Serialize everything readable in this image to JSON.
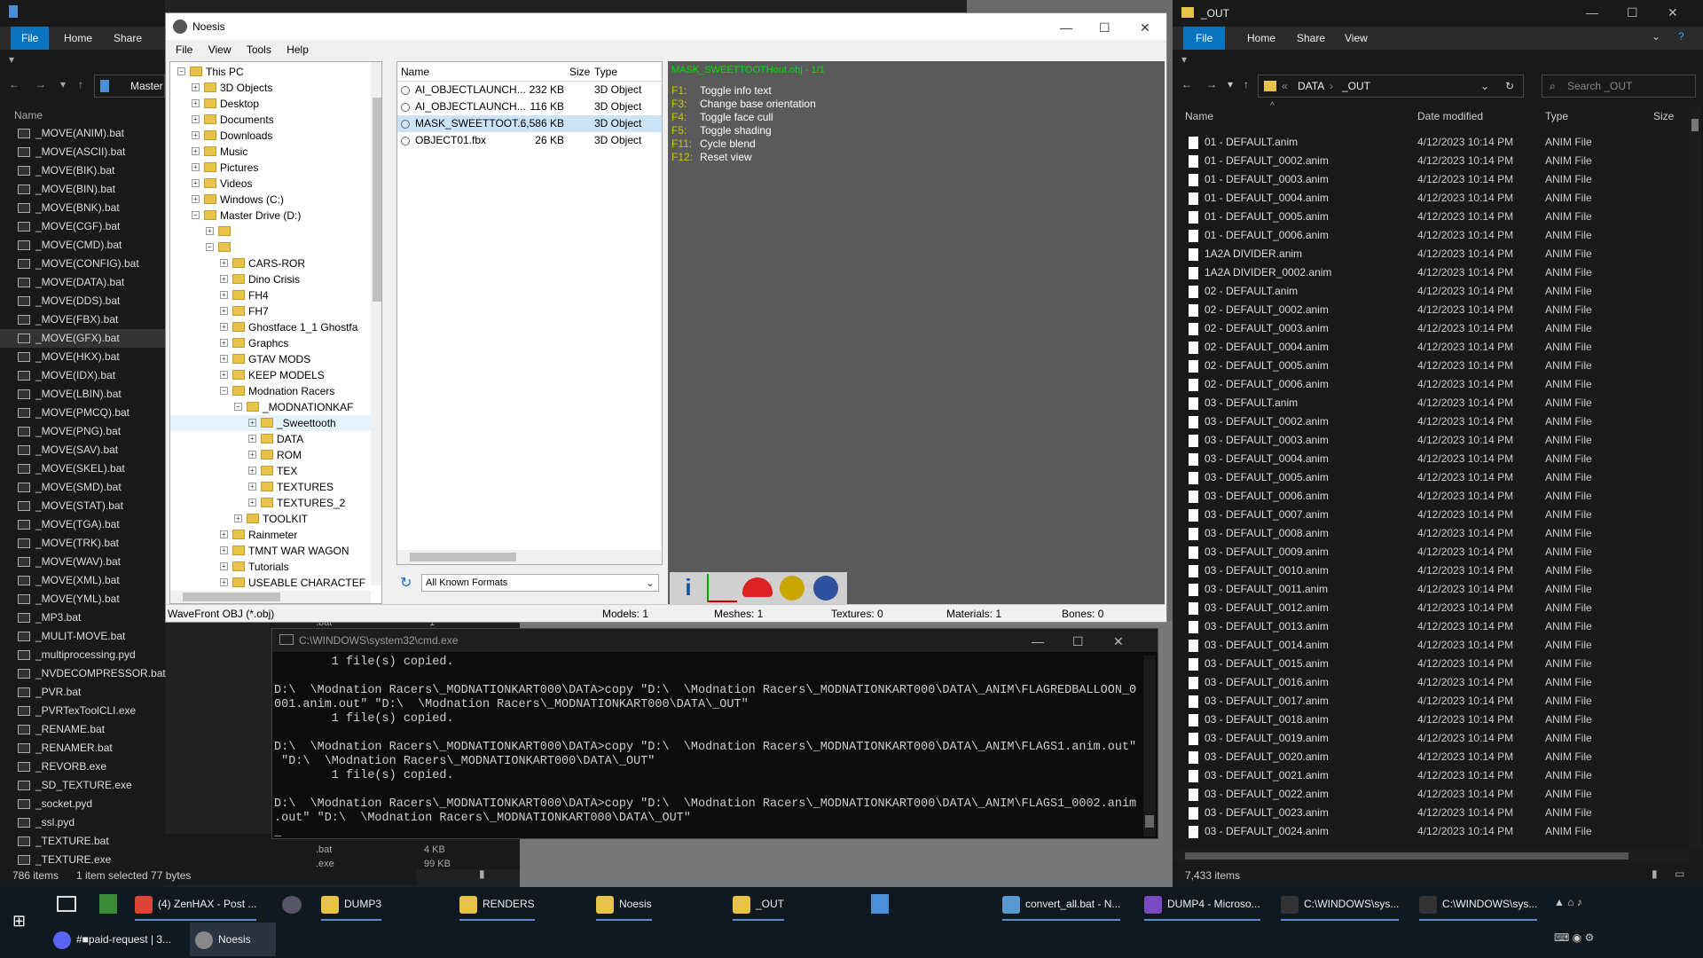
{
  "left_explorer": {
    "ribbon": {
      "file": "File",
      "home": "Home",
      "share": "Share"
    },
    "address": "Master",
    "col_name": "Name",
    "files": [
      "_MOVE(ANIM).bat",
      "_MOVE(ASCII).bat",
      "_MOVE(BIK).bat",
      "_MOVE(BIN).bat",
      "_MOVE(BNK).bat",
      "_MOVE(CGF).bat",
      "_MOVE(CMD).bat",
      "_MOVE(CONFIG).bat",
      "_MOVE(DATA).bat",
      "_MOVE(DDS).bat",
      "_MOVE(FBX).bat",
      "_MOVE(GFX).bat",
      "_MOVE(HKX).bat",
      "_MOVE(IDX).bat",
      "_MOVE(LBIN).bat",
      "_MOVE(PMCQ).bat",
      "_MOVE(PNG).bat",
      "_MOVE(SAV).bat",
      "_MOVE(SKEL).bat",
      "_MOVE(SMD).bat",
      "_MOVE(STAT).bat",
      "_MOVE(TGA).bat",
      "_MOVE(TRK).bat",
      "_MOVE(WAV).bat",
      "_MOVE(XML).bat",
      "_MOVE(YML).bat",
      "_MP3.bat",
      "_MULIT-MOVE.bat",
      "_multiprocessing.pyd",
      "_NVDECOMPRESSOR.bat",
      "_PVR.bat",
      "_PVRTexToolCLI.exe",
      "_RENAME.bat",
      "_RENAMER.bat",
      "_REVORB.exe",
      "_SD_TEXTURE.exe",
      "_socket.pyd",
      "_ssl.pyd",
      "_TEXTURE.bat",
      "_TEXTURE.exe"
    ],
    "status": "786 items",
    "status_sel": "1 item selected  77 bytes",
    "extra_type": ".bat",
    "extra_size": "4 KB",
    "extra_type2": ".exe",
    "extra_size2": "99 KB",
    "extra_type0": ".bat",
    "extra_size0": "1 KB"
  },
  "noesis": {
    "title": "Noesis",
    "menu": [
      "File",
      "View",
      "Tools",
      "Help"
    ],
    "tree": [
      {
        "label": "This PC",
        "indent": 0
      },
      {
        "label": "3D Objects",
        "indent": 1
      },
      {
        "label": "Desktop",
        "indent": 1
      },
      {
        "label": "Documents",
        "indent": 1
      },
      {
        "label": "Downloads",
        "indent": 1
      },
      {
        "label": "Music",
        "indent": 1
      },
      {
        "label": "Pictures",
        "indent": 1
      },
      {
        "label": "Videos",
        "indent": 1
      },
      {
        "label": "Windows  (C:)",
        "indent": 1
      },
      {
        "label": "Master Drive (D:)",
        "indent": 1
      },
      {
        "label": "",
        "indent": 2
      },
      {
        "label": "",
        "indent": 2
      },
      {
        "label": "CARS-ROR",
        "indent": 3
      },
      {
        "label": "Dino Crisis",
        "indent": 3
      },
      {
        "label": "FH4",
        "indent": 3
      },
      {
        "label": "FH7",
        "indent": 3
      },
      {
        "label": "Ghostface 1_1 Ghostfa",
        "indent": 3
      },
      {
        "label": "Graphcs",
        "indent": 3
      },
      {
        "label": "GTAV MODS",
        "indent": 3
      },
      {
        "label": "KEEP MODELS",
        "indent": 3
      },
      {
        "label": "Modnation Racers",
        "indent": 3
      },
      {
        "label": "_MODNATIONKAF",
        "indent": 4
      },
      {
        "label": "_Sweettooth",
        "indent": 5
      },
      {
        "label": "DATA",
        "indent": 5
      },
      {
        "label": "ROM",
        "indent": 5
      },
      {
        "label": "TEX",
        "indent": 5
      },
      {
        "label": "TEXTURES",
        "indent": 5
      },
      {
        "label": "TEXTURES_2",
        "indent": 5
      },
      {
        "label": "TOOLKIT",
        "indent": 4
      },
      {
        "label": "Rainmeter",
        "indent": 3
      },
      {
        "label": "TMNT WAR WAGON",
        "indent": 3
      },
      {
        "label": "Tutorials",
        "indent": 3
      },
      {
        "label": "USEABLE CHARACTEF",
        "indent": 3
      }
    ],
    "file_cols": {
      "name": "Name",
      "size": "Size",
      "type": "Type"
    },
    "files": [
      {
        "name": "AI_OBJECTLAUNCH...",
        "size": "232 KB",
        "type": "3D Object"
      },
      {
        "name": "AI_OBJECTLAUNCH...",
        "size": "116 KB",
        "type": "3D Object"
      },
      {
        "name": "MASK_SWEETTOOT...",
        "size": "6,586 KB",
        "type": "3D Object"
      },
      {
        "name": "OBJECT01.fbx",
        "size": "26 KB",
        "type": "3D Object"
      }
    ],
    "format_select": "All Known Formats",
    "viewer_title": "MASK_SWEETTOOTHout.obj - 1/1",
    "help": [
      {
        "key": "F1:",
        "text": "Toggle info text"
      },
      {
        "key": "F3:",
        "text": "Change base orientation"
      },
      {
        "key": "F4:",
        "text": "Toggle face cull"
      },
      {
        "key": "F5:",
        "text": "Toggle shading"
      },
      {
        "key": "F11:",
        "text": "Cycle blend"
      },
      {
        "key": "F12:",
        "text": "Reset view"
      }
    ],
    "status": {
      "format": "WaveFront OBJ (*.obj)",
      "models": "Models: 1",
      "meshes": "Meshes: 1",
      "textures": "Textures: 0",
      "materials": "Materials: 1",
      "bones": "Bones: 0"
    }
  },
  "cmd": {
    "title": "C:\\WINDOWS\\system32\\cmd.exe",
    "lines": [
      "        1 file(s) copied.",
      "",
      "D:\\  \\Modnation Racers\\_MODNATIONKART000\\DATA>copy \"D:\\  \\Modnation Racers\\_MODNATIONKART000\\DATA\\_ANIM\\FLAGREDBALLOON_0",
      "001.anim.out\" \"D:\\  \\Modnation Racers\\_MODNATIONKART000\\DATA\\_OUT\"",
      "        1 file(s) copied.",
      "",
      "D:\\  \\Modnation Racers\\_MODNATIONKART000\\DATA>copy \"D:\\  \\Modnation Racers\\_MODNATIONKART000\\DATA\\_ANIM\\FLAGS1.anim.out\"",
      " \"D:\\  \\Modnation Racers\\_MODNATIONKART000\\DATA\\_OUT\"",
      "        1 file(s) copied.",
      "",
      "D:\\  \\Modnation Racers\\_MODNATIONKART000\\DATA>copy \"D:\\  \\Modnation Racers\\_MODNATIONKART000\\DATA\\_ANIM\\FLAGS1_0002.anim",
      ".out\" \"D:\\  \\Modnation Racers\\_MODNATIONKART000\\DATA\\_OUT\"",
      "_"
    ]
  },
  "right_explorer": {
    "title": "_OUT",
    "ribbon": {
      "file": "File",
      "home": "Home",
      "share": "Share",
      "view": "View"
    },
    "crumb1": "DATA",
    "crumb2": "_OUT",
    "search_placeholder": "Search _OUT",
    "cols": {
      "name": "Name",
      "date": "Date modified",
      "type": "Type",
      "size": "Size"
    },
    "files": [
      "01 - DEFAULT.anim",
      "01 - DEFAULT_0002.anim",
      "01 - DEFAULT_0003.anim",
      "01 - DEFAULT_0004.anim",
      "01 - DEFAULT_0005.anim",
      "01 - DEFAULT_0006.anim",
      "1A2A DIVIDER.anim",
      "1A2A DIVIDER_0002.anim",
      "02 - DEFAULT.anim",
      "02 - DEFAULT_0002.anim",
      "02 - DEFAULT_0003.anim",
      "02 - DEFAULT_0004.anim",
      "02 - DEFAULT_0005.anim",
      "02 - DEFAULT_0006.anim",
      "03 - DEFAULT.anim",
      "03 - DEFAULT_0002.anim",
      "03 - DEFAULT_0003.anim",
      "03 - DEFAULT_0004.anim",
      "03 - DEFAULT_0005.anim",
      "03 - DEFAULT_0006.anim",
      "03 - DEFAULT_0007.anim",
      "03 - DEFAULT_0008.anim",
      "03 - DEFAULT_0009.anim",
      "03 - DEFAULT_0010.anim",
      "03 - DEFAULT_0011.anim",
      "03 - DEFAULT_0012.anim",
      "03 - DEFAULT_0013.anim",
      "03 - DEFAULT_0014.anim",
      "03 - DEFAULT_0015.anim",
      "03 - DEFAULT_0016.anim",
      "03 - DEFAULT_0017.anim",
      "03 - DEFAULT_0018.anim",
      "03 - DEFAULT_0019.anim",
      "03 - DEFAULT_0020.anim",
      "03 - DEFAULT_0021.anim",
      "03 - DEFAULT_0022.anim",
      "03 - DEFAULT_0023.anim",
      "03 - DEFAULT_0024.anim"
    ],
    "date": "4/12/2023 10:14 PM",
    "type": "ANIM File",
    "status": "7,433 items"
  },
  "taskbar": {
    "row1": [
      {
        "label": "(4) ZenHAX - Post ...",
        "icon": "chrome-icon"
      },
      {
        "label": "DUMP3",
        "icon": "folder-icon"
      },
      {
        "label": "RENDERS",
        "icon": "folder-icon"
      },
      {
        "label": "Noesis",
        "icon": "folder-icon"
      },
      {
        "label": "_OUT",
        "icon": "folder-icon"
      },
      {
        "label": "convert_all.bat - N...",
        "icon": "notepad-icon"
      },
      {
        "label": "DUMP4 - Microso...",
        "icon": "vs-icon"
      },
      {
        "label": "C:\\WINDOWS\\sys...",
        "icon": "cmd-icon"
      },
      {
        "label": "C:\\WINDOWS\\sys...",
        "icon": "cmd-icon"
      }
    ],
    "row2": [
      {
        "label": "#■paid-request | 3...",
        "icon": "discord-icon"
      },
      {
        "label": "Noesis",
        "icon": "noesis-icon"
      }
    ]
  }
}
